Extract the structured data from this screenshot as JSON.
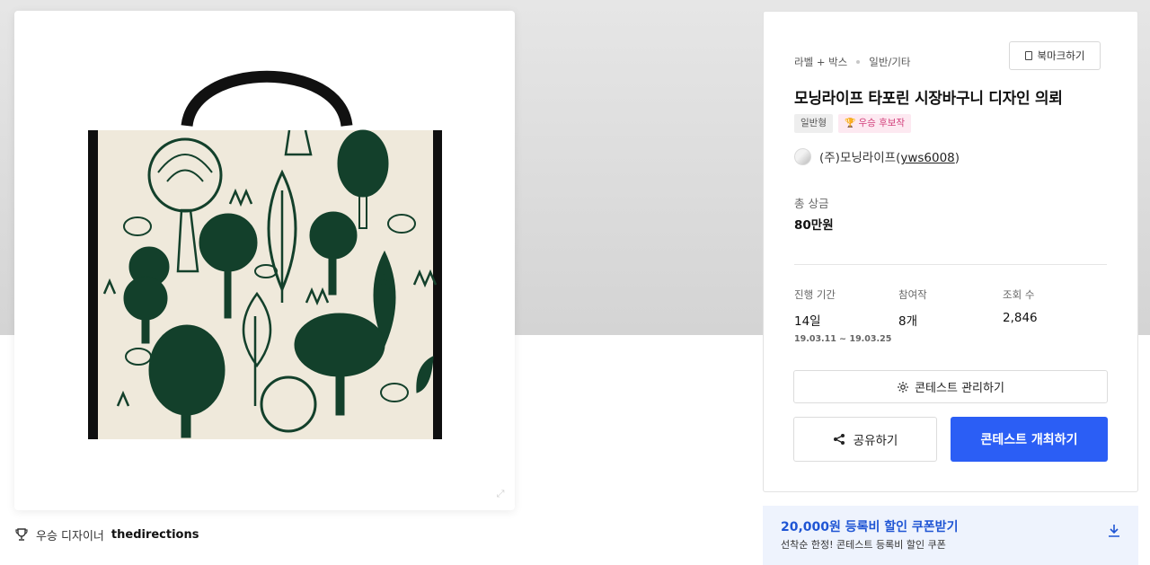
{
  "winner": {
    "prefix": "우승 디자이너",
    "name": "thedirections"
  },
  "contest": {
    "category_main": "라벨 + 박스",
    "category_sub": "일반/기타",
    "bookmark_label": "북마크하기",
    "title": "모닝라이프 타포린 시장바구니 디자인 의뢰",
    "tag_general": "일반형",
    "tag_award": "우승 후보작",
    "host_name": "(주)모닝라이프",
    "host_id": "yws6008",
    "prize_label": "총 상금",
    "prize_value": "80만원"
  },
  "stats": {
    "period_label": "진행 기간",
    "period_value": "14일",
    "period_range": "19.03.11 ~ 19.03.25",
    "entries_label": "참여작",
    "entries_value": "8개",
    "views_label": "조회 수",
    "views_value": "2,846"
  },
  "actions": {
    "manage_label": "콘테스트 관리하기",
    "share_label": "공유하기",
    "host_label": "콘테스트 개최하기"
  },
  "coupon": {
    "title": "20,000원 등록비 할인 쿠폰받기",
    "subtitle": "선착순 한정! 콘테스트 등록비 할인 쿠폰"
  },
  "colors": {
    "primary": "#2b5ef5",
    "coupon_bg": "#eef3fd",
    "pattern_green": "#13402b",
    "pattern_bg": "#efe9db"
  },
  "icons": [
    "trophy-icon",
    "bookmark-icon",
    "gear-icon",
    "share-icon",
    "download-icon",
    "zoom-icon"
  ]
}
